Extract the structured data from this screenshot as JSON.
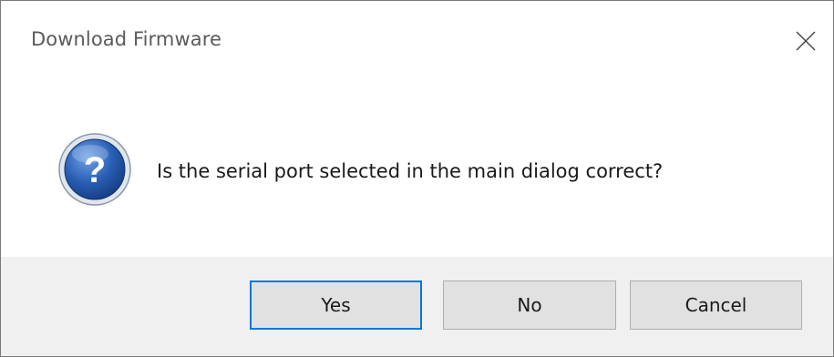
{
  "dialog": {
    "title": "Download Firmware",
    "message": "Is the serial port selected in the main dialog correct?",
    "icon": "question-icon",
    "buttons": {
      "yes": "Yes",
      "no": "No",
      "cancel": "Cancel"
    }
  },
  "colors": {
    "accent": "#0078d7",
    "footer_bg": "#f0f0f0",
    "button_bg": "#e1e1e1",
    "icon_blue": "#1e4f9c"
  }
}
